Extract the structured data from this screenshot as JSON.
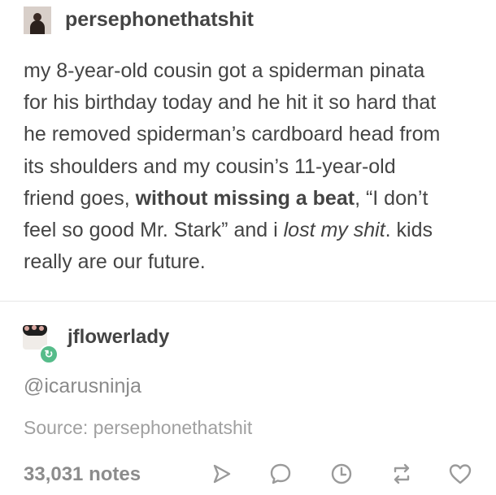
{
  "post": {
    "author": "persephonethatshit",
    "body_lines": [
      "my 8-year-old cousin got a spiderman pinata",
      "for his birthday today and he hit it so hard that",
      "he removed spiderman’s cardboard head from",
      "its shoulders and my cousin’s 11-year-old"
    ],
    "line5_pre": "friend goes, ",
    "line5_bold": "without missing a beat",
    "line5_post": ", “I don’t",
    "line6_pre": "feel so good Mr. Stark” and i ",
    "line6_italic": "lost my shit",
    "line6_post": ". kids",
    "line7": "really are our future."
  },
  "reblog": {
    "username": "jflowerlady",
    "mention": "@icarusninja"
  },
  "footer": {
    "source": "Source: persephonethatshit",
    "notes": "33,031 notes"
  },
  "icons": [
    "share-icon",
    "reply-icon",
    "history-icon",
    "reblog-icon",
    "like-icon"
  ],
  "colors": {
    "text": "#444444",
    "muted": "#8c8c8c",
    "reblog_badge": "#56bc8a"
  }
}
